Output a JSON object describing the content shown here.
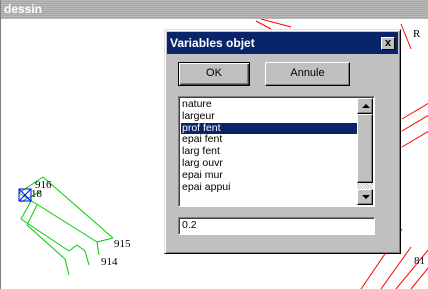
{
  "background_window": {
    "title": "dessin"
  },
  "drawing": {
    "point_labels": [
      "916",
      "18",
      "915",
      "914"
    ],
    "edge_glyphs": [
      "R",
      "81"
    ]
  },
  "dialog": {
    "title": "Variables objet",
    "close_glyph": "x",
    "ok_label": "OK",
    "cancel_label": "Annule",
    "list_items": [
      "nature",
      "largeur",
      "prof fent",
      "epai fent",
      "larg fent",
      "larg ouvr",
      "epai mur",
      "epai appui"
    ],
    "selected_item": "prof fent",
    "value": "0.2"
  },
  "colors": {
    "dialog_title_bg": "#0a246a",
    "selection_bg": "#0a246a",
    "green_lines": "#00cc00",
    "red_lines": "#ff0000",
    "marker_blue": "#0000ff"
  }
}
